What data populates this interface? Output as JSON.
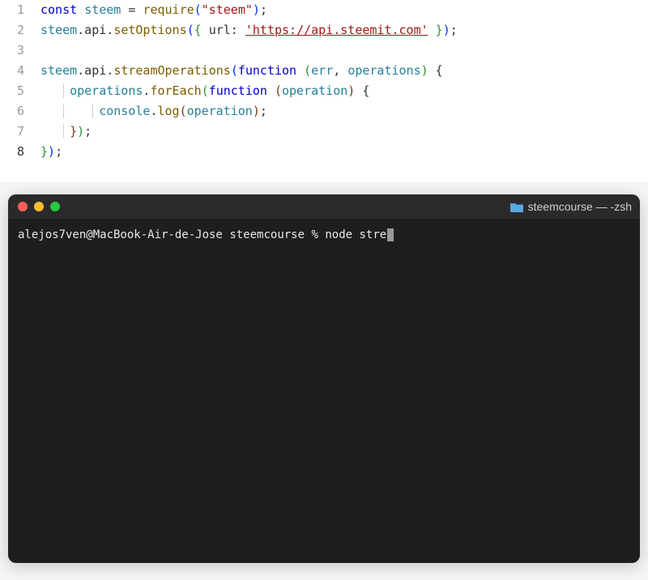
{
  "editor": {
    "lines": [
      {
        "num": "1"
      },
      {
        "num": "2"
      },
      {
        "num": "3"
      },
      {
        "num": "4"
      },
      {
        "num": "5"
      },
      {
        "num": "6"
      },
      {
        "num": "7"
      },
      {
        "num": "8"
      }
    ],
    "active_line": "8",
    "tokens": {
      "l1_const": "const",
      "l1_steem": "steem",
      "l1_eq": " = ",
      "l1_require": "require",
      "l1_open": "(",
      "l1_str": "\"steem\"",
      "l1_close": ")",
      "l1_semi": ";",
      "l2_steem": "steem",
      "l2_dot1": ".api.",
      "l2_setOptions": "setOptions",
      "l2_open": "(",
      "l2_brace_o": "{",
      "l2_url": " url: ",
      "l2_str": "'https://api.steemit.com'",
      "l2_brace_c": " }",
      "l2_close": ")",
      "l2_semi": ";",
      "l4_steem": "steem",
      "l4_dot1": ".api.",
      "l4_stream": "streamOperations",
      "l4_open": "(",
      "l4_func": "function",
      "l4_sp": " ",
      "l4_p_o": "(",
      "l4_err": "err",
      "l4_comma": ", ",
      "l4_ops": "operations",
      "l4_p_c": ")",
      "l4_brace": " {",
      "l5_ops": "operations",
      "l5_dot": ".",
      "l5_foreach": "forEach",
      "l5_open": "(",
      "l5_func": "function",
      "l5_sp": " ",
      "l5_p_o": "(",
      "l5_op": "operation",
      "l5_p_c": ")",
      "l5_brace": " {",
      "l6_console": "console",
      "l6_dot": ".",
      "l6_log": "log",
      "l6_open": "(",
      "l6_op": "operation",
      "l6_close": ")",
      "l6_semi": ";",
      "l7_close_b": "}",
      "l7_close_p": ")",
      "l7_semi": ";",
      "l8_close_b": "}",
      "l8_close_p": ")",
      "l8_semi": ";"
    }
  },
  "terminal": {
    "title": "steemcourse — -zsh",
    "prompt_user": "alejos7ven@MacBook-Air-de-Jose",
    "prompt_path": "steemcourse",
    "prompt_char": "%",
    "command": "node stre"
  }
}
